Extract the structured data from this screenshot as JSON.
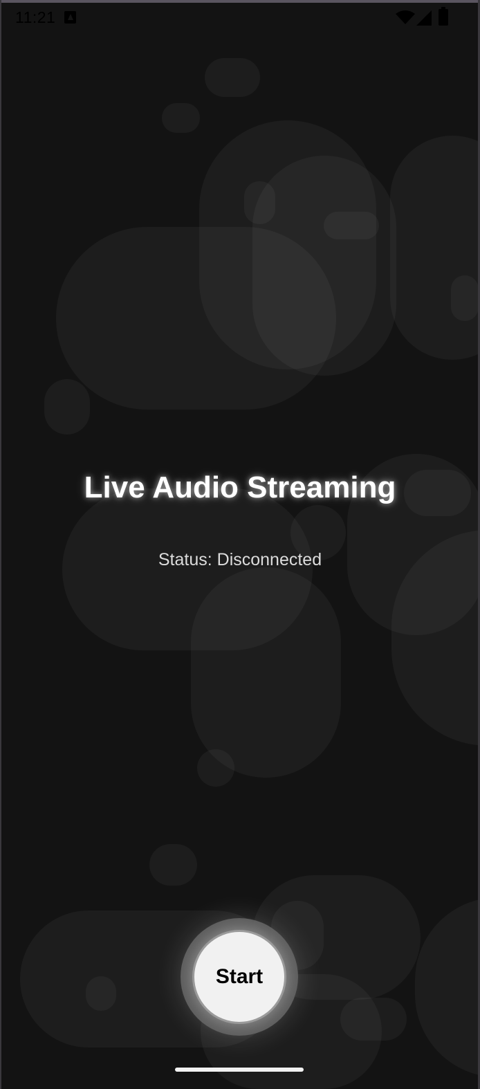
{
  "status_bar": {
    "time": "11:21",
    "notification_icon": "alert-triangle-icon",
    "wifi_icon": "wifi-icon",
    "signal_icon": "cell-signal-icon",
    "battery_icon": "battery-icon"
  },
  "main": {
    "title": "Live Audio Streaming",
    "status": "Status: Disconnected"
  },
  "controls": {
    "start_label": "Start"
  },
  "colors": {
    "background": "#131313",
    "title": "#ffffff",
    "status_text": "#dcdcdc",
    "button_fill": "#f1f1f1",
    "button_text": "#000000"
  }
}
